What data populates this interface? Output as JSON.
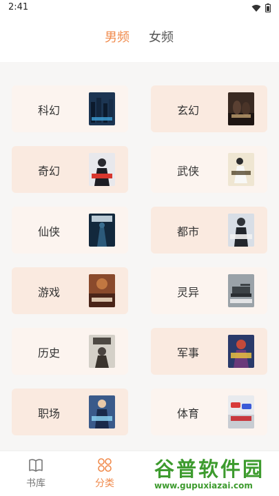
{
  "status": {
    "time": "2:41"
  },
  "tabs": [
    {
      "label": "男频",
      "active": true
    },
    {
      "label": "女频",
      "active": false
    }
  ],
  "categories": [
    {
      "label": "科幻",
      "cover": "city skyline at night"
    },
    {
      "label": "玄幻",
      "cover": "dark warriors"
    },
    {
      "label": "奇幻",
      "cover": "man in dark coat"
    },
    {
      "label": "武侠",
      "cover": "swordsman in white"
    },
    {
      "label": "仙侠",
      "cover": "blue mystic figure"
    },
    {
      "label": "都市",
      "cover": "man in suit"
    },
    {
      "label": "游戏",
      "cover": "red battlefield"
    },
    {
      "label": "灵异",
      "cover": "tank in fog"
    },
    {
      "label": "历史",
      "cover": "ancient figure"
    },
    {
      "label": "军事",
      "cover": "armored soldier"
    },
    {
      "label": "职场",
      "cover": "man in blue suit"
    },
    {
      "label": "体育",
      "cover": "racing cars"
    }
  ],
  "nav": {
    "shelf_label": "书库",
    "category_label": "分类"
  },
  "watermark": {
    "title": "谷普软件园",
    "url": "www.gupuxiazai.com"
  },
  "colors": {
    "accent": "#f08a4b",
    "card_dark": "#faeae0",
    "card_light": "#fcf4ef",
    "watermark": "#3d9b2e"
  }
}
